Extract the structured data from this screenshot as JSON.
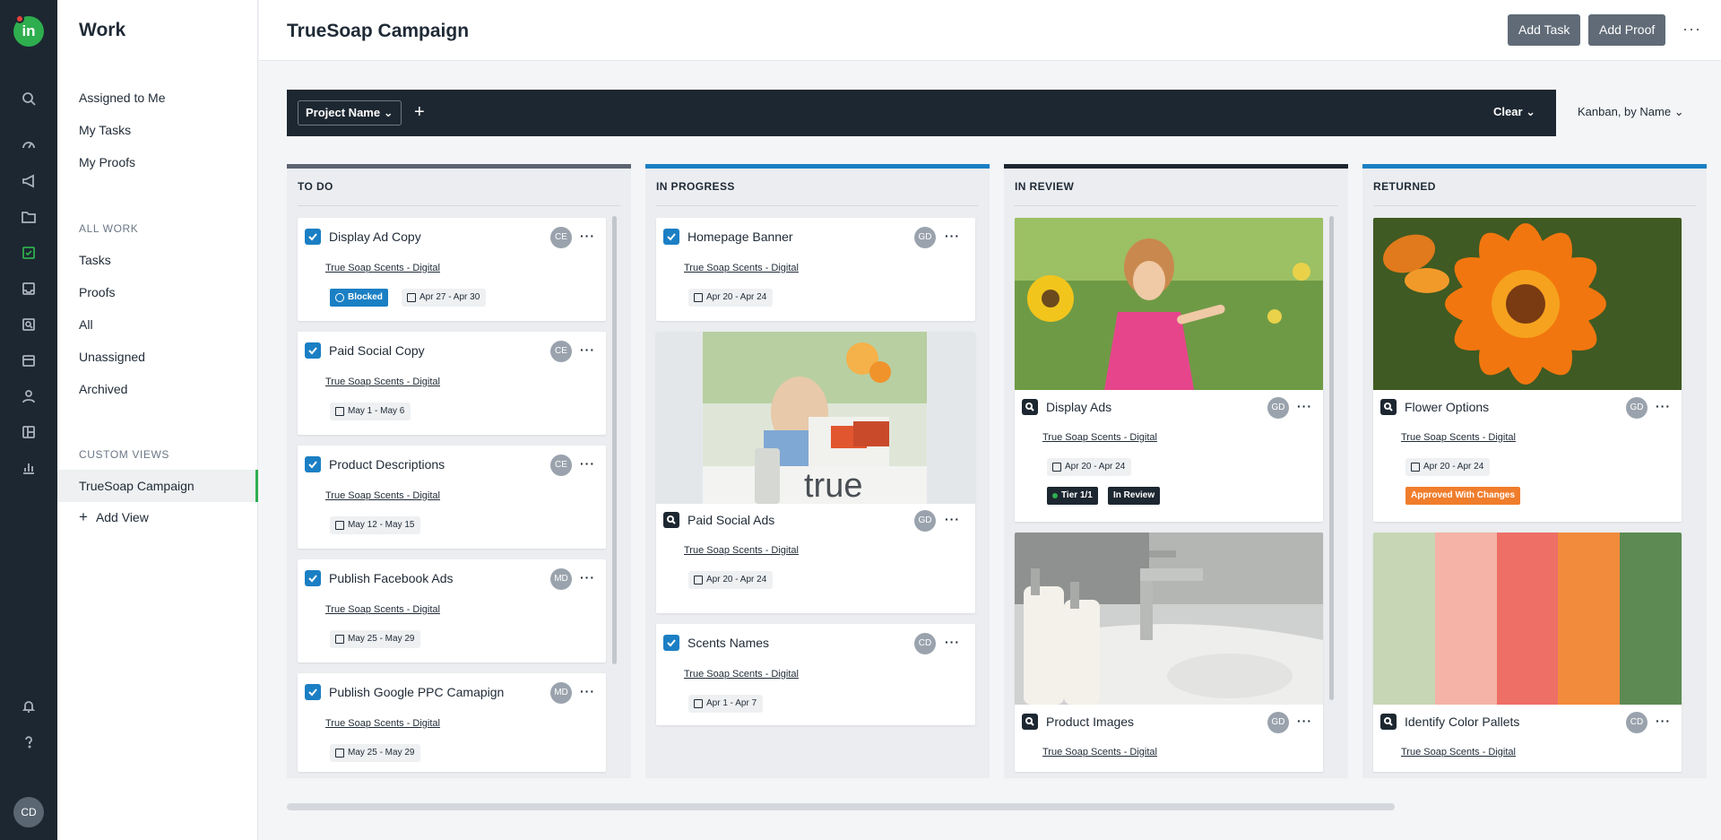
{
  "app": {
    "logo_text": "in",
    "user_initials": "CD"
  },
  "rail": {
    "icons": [
      "search-icon",
      "dashboard-icon",
      "megaphone-icon",
      "folder-icon",
      "tasks-icon",
      "inbox-icon",
      "proofs-icon",
      "calendar-icon",
      "people-icon",
      "layout-icon",
      "reports-icon",
      "notifications-icon",
      "help-icon"
    ]
  },
  "nav": {
    "title": "Work",
    "top_items": [
      "Assigned to Me",
      "My Tasks",
      "My Proofs"
    ],
    "all_work_label": "ALL WORK",
    "all_work_items": [
      "Tasks",
      "Proofs",
      "All",
      "Unassigned",
      "Archived"
    ],
    "custom_views_label": "CUSTOM VIEWS",
    "custom_view_selected": "TrueSoap Campaign",
    "add_view_label": "Add View"
  },
  "header": {
    "title": "TrueSoap Campaign",
    "add_task": "Add Task",
    "add_proof": "Add Proof",
    "more": "···"
  },
  "filter": {
    "project_name": "Project Name",
    "plus": "+",
    "clear": "Clear",
    "view_select": "Kanban, by Name"
  },
  "columns": [
    {
      "title": "TO DO",
      "color": "#5b6470",
      "cards": [
        {
          "name": "Display Ad Copy",
          "initials": "CE",
          "project": "True Soap Scents - Digital",
          "dates": "Apr 27 - Apr 30",
          "status": "Blocked"
        },
        {
          "name": "Paid Social Copy",
          "initials": "CE",
          "project": "True Soap Scents - Digital",
          "dates": "May 1 - May 6"
        },
        {
          "name": "Product Descriptions",
          "initials": "CE",
          "project": "True Soap Scents - Digital",
          "dates": "May 12 - May 15"
        },
        {
          "name": "Publish Facebook Ads",
          "initials": "MD",
          "project": "True Soap Scents - Digital",
          "dates": "May 25 - May 29"
        },
        {
          "name": "Publish Google PPC Camapign",
          "initials": "MD",
          "project": "True Soap Scents - Digital",
          "dates": "May 25 - May 29"
        }
      ]
    },
    {
      "title": "IN PROGRESS",
      "color": "#1b7fc4",
      "cards": [
        {
          "name": "Homepage Banner",
          "initials": "GD",
          "project": "True Soap Scents - Digital",
          "dates": "Apr 20 - Apr 24"
        },
        {
          "name": "Paid Social Ads",
          "initials": "GD",
          "project": "True Soap Scents - Digital",
          "dates": "Apr 20 - Apr 24",
          "image_text": "true"
        },
        {
          "name": "Scents Names",
          "initials": "CD",
          "project": "True Soap Scents - Digital",
          "dates": "Apr 1 - Apr 7"
        }
      ]
    },
    {
      "title": "IN REVIEW",
      "color": "#1d2731",
      "cards": [
        {
          "name": "Display Ads",
          "initials": "GD",
          "project": "True Soap Scents - Digital",
          "dates": "Apr 20 - Apr 24",
          "tier": "Tier 1/1",
          "review": "In Review"
        },
        {
          "name": "Product Images",
          "initials": "GD",
          "project": "True Soap Scents - Digital"
        }
      ]
    },
    {
      "title": "RETURNED",
      "color": "#1b7fc4",
      "cards": [
        {
          "name": "Flower Options",
          "initials": "GD",
          "project": "True Soap Scents - Digital",
          "dates": "Apr 20 - Apr 24",
          "status": "Approved With Changes"
        },
        {
          "name": "Identify Color Pallets",
          "initials": "CD",
          "project": "True Soap Scents - Digital"
        }
      ]
    }
  ],
  "colors": {
    "blocked": "#1b7fc4",
    "approved_with_changes": "#f07d2c",
    "tag_dark": "#1d2731",
    "tier_dot": "#2eae4e"
  },
  "palette": [
    "#c7d7b5",
    "#f4b3a6",
    "#ee6f66",
    "#f28b3c",
    "#5c8a52"
  ]
}
